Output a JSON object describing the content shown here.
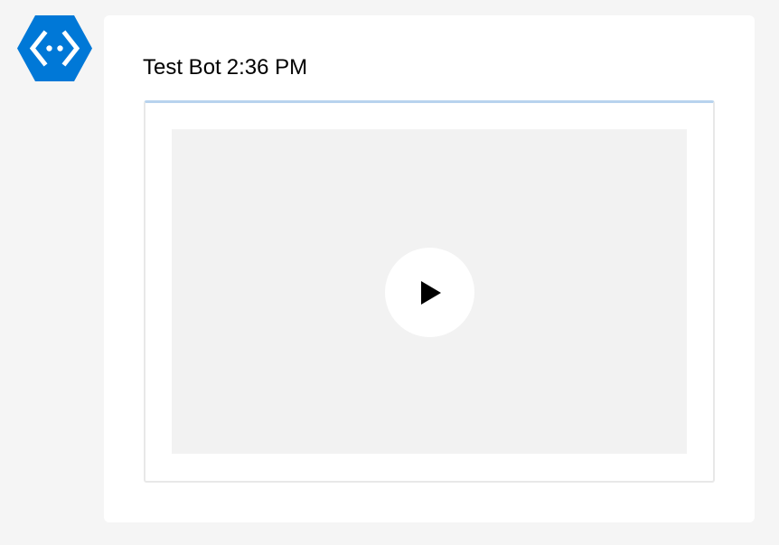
{
  "colors": {
    "page_background": "#f5f5f5",
    "bubble_background": "#ffffff",
    "avatar_blue": "#0078d7",
    "card_top_accent": "#b8d3ee",
    "video_background": "#f2f2f2"
  },
  "avatar": {
    "icon": "bot-service-icon"
  },
  "message": {
    "sender": "Test Bot",
    "timestamp": "2:36 PM"
  },
  "attachment": {
    "type": "video",
    "play_icon": "play-icon"
  }
}
